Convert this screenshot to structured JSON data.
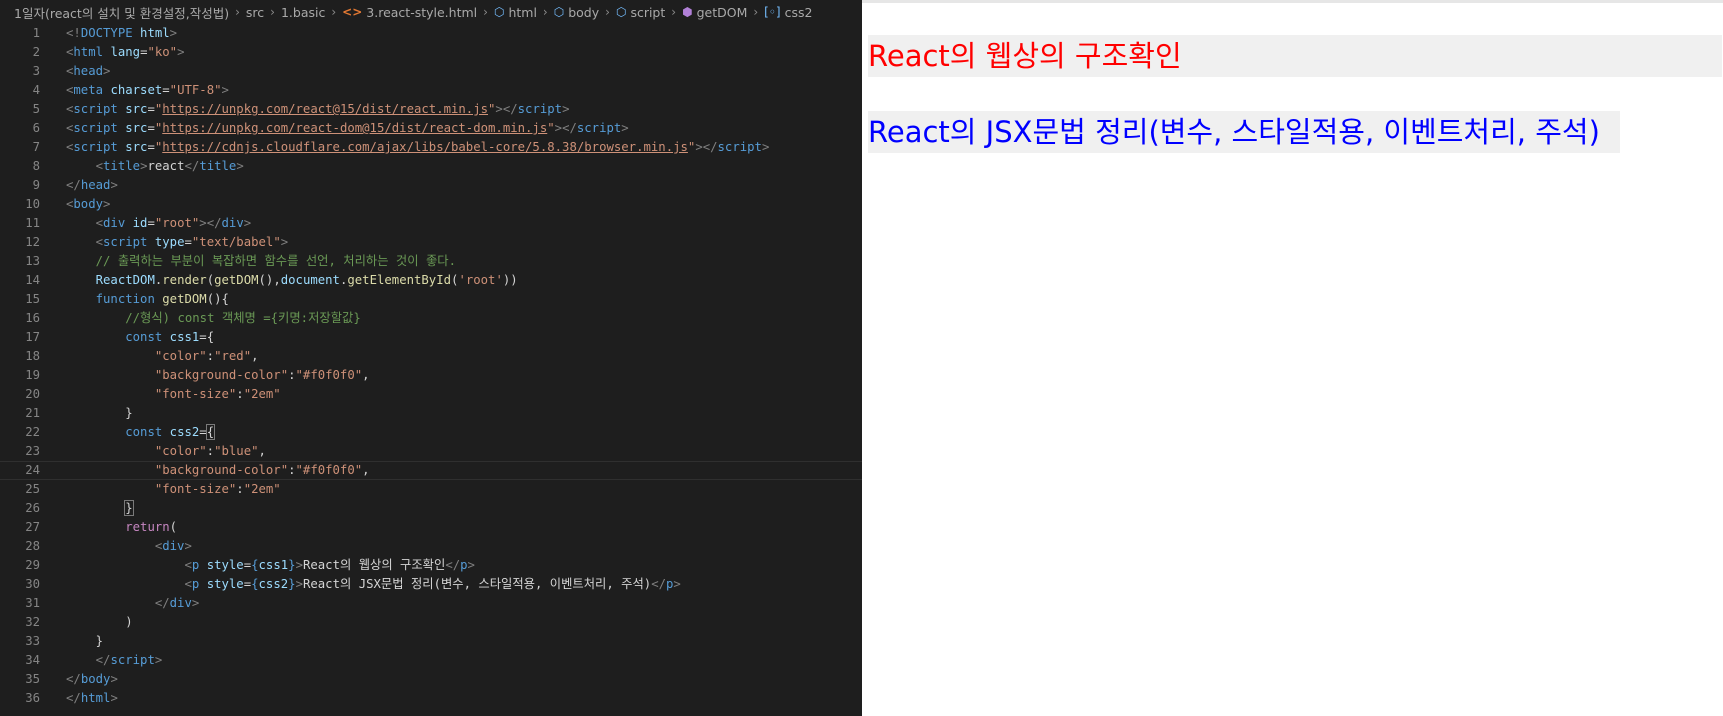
{
  "breadcrumb": {
    "items": [
      {
        "label": "1일자(react의 설치 및 환경설정,작성법)",
        "icon": ""
      },
      {
        "label": "src",
        "icon": ""
      },
      {
        "label": "1.basic",
        "icon": ""
      },
      {
        "label": "3.react-style.html",
        "icon": "html-file-icon"
      },
      {
        "label": "html",
        "icon": "cube-icon"
      },
      {
        "label": "body",
        "icon": "cube-icon"
      },
      {
        "label": "script",
        "icon": "cube-icon"
      },
      {
        "label": "getDOM",
        "icon": "function-icon"
      },
      {
        "label": "css2",
        "icon": "variable-icon"
      }
    ]
  },
  "code": {
    "line_numbers": [
      "1",
      "2",
      "3",
      "4",
      "5",
      "6",
      "7",
      "8",
      "9",
      "10",
      "11",
      "12",
      "13",
      "14",
      "15",
      "16",
      "17",
      "18",
      "19",
      "20",
      "21",
      "22",
      "23",
      "24",
      "25",
      "26",
      "27",
      "28",
      "29",
      "30",
      "31",
      "32",
      "33",
      "34",
      "35",
      "36"
    ],
    "t": {
      "doctype_open": "<!",
      "doctype": "DOCTYPE",
      "html": "html",
      "lang": "lang",
      "eq": "=",
      "ko": "\"ko\"",
      "lt": "<",
      "gt": ">",
      "lts": "</",
      "head": "head",
      "meta": "meta",
      "charset": "charset",
      "utf8": "\"UTF-8\"",
      "script": "script",
      "src": "src",
      "q": "\"",
      "url1": "https://unpkg.com/react@15/dist/react.min.js",
      "url2": "https://unpkg.com/react-dom@15/dist/react-dom.min.js",
      "url3": "https://cdnjs.cloudflare.com/ajax/libs/babel-core/5.8.38/browser.min.js",
      "title": "title",
      "title_text": "react",
      "body": "body",
      "div": "div",
      "id": "id",
      "root_str": "\"root\"",
      "type": "type",
      "babel_str": "\"text/babel\"",
      "comment1": "// 출력하는 부분이 복잡하면 함수를 선언, 처리하는 것이 좋다.",
      "reactdom": "ReactDOM",
      "dot": ".",
      "render": "render",
      "lparen": "(",
      "rparen": ")",
      "getdom": "getDOM",
      "call_empty": "()",
      "comma": ",",
      "document": "document",
      "getelementbyid": "getElementById",
      "root_sq": "'root'",
      "close_call": "))",
      "function": "function",
      "open_brace": "{",
      "close_brace": "}",
      "comment2": "//형식) const 객체명 ={키명:저장할값}",
      "const": "const",
      "css1": "css1",
      "css2": "css2",
      "eq_brace": "={",
      "k_color": "\"color\"",
      "colon": ":",
      "v_red": "\"red\"",
      "k_bg": "\"background-color\"",
      "v_bg": "\"#f0f0f0\"",
      "k_fs": "\"font-size\"",
      "v_fs": "\"2em\"",
      "v_blue": "\"blue\"",
      "return": "return",
      "p": "p",
      "style": "style",
      "p1_text": "React의 웹상의 구조확인",
      "p2_text": "React의 JSX문법 정리(변수, 스타일적용, 이벤트처리, 주석)"
    }
  },
  "preview": {
    "p1": "React의 웹상의 구조확인",
    "p2": "React의 JSX문법 정리(변수, 스타일적용, 이벤트처리, 주석)",
    "p1_color": "#ff0000",
    "p2_color": "#0000ff",
    "background": "#f0f0f0"
  }
}
